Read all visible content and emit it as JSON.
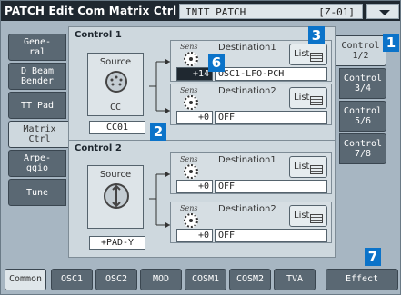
{
  "header": {
    "title": "PATCH Edit Com Matrix Ctrl",
    "patch_name": "INIT PATCH",
    "patch_number": "[Z-01]"
  },
  "left_tabs": [
    {
      "label": "Gene-\nral"
    },
    {
      "label": "D Beam\nBender"
    },
    {
      "label": "TT Pad"
    },
    {
      "label": "Matrix\nCtrl"
    },
    {
      "label": "Arpe-\nggio"
    },
    {
      "label": "Tune"
    }
  ],
  "control1": {
    "label": "Control 1",
    "source_label": "Source",
    "source_type": "CC",
    "source_value": "CC01",
    "dest1": {
      "sens_label": "Sens",
      "label": "Destination1",
      "sens": "+14",
      "value": "OSC1-LFO-PCH",
      "list": "List"
    },
    "dest2": {
      "sens_label": "Sens",
      "label": "Destination2",
      "sens": "+0",
      "value": "OFF",
      "list": "List"
    }
  },
  "control2": {
    "label": "Control 2",
    "source_label": "Source",
    "source_value": "+PAD-Y",
    "dest1": {
      "sens_label": "Sens",
      "label": "Destination1",
      "sens": "+0",
      "value": "OFF",
      "list": "List"
    },
    "dest2": {
      "sens_label": "Sens",
      "label": "Destination2",
      "sens": "+0",
      "value": "OFF",
      "list": "List"
    }
  },
  "right_tabs": [
    {
      "label": "Control\n1/2"
    },
    {
      "label": "Control\n3/4"
    },
    {
      "label": "Control\n5/6"
    },
    {
      "label": "Control\n7/8"
    }
  ],
  "bottom_tabs": [
    "Common",
    "OSC1",
    "OSC2",
    "MOD",
    "COSM1",
    "COSM2",
    "TVA",
    "Effect"
  ],
  "callouts": [
    "1",
    "2",
    "3",
    "6",
    "7"
  ],
  "colors": {
    "callout": "#0b73c9",
    "titlebar": "#1f2830",
    "tab": "#5a6873",
    "panel": "#ced8de"
  }
}
